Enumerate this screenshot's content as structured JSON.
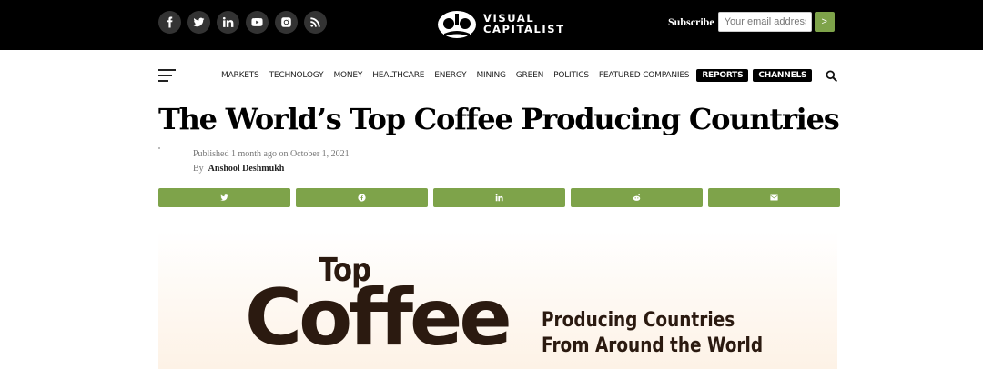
{
  "header": {
    "social_icons": [
      "facebook-icon",
      "twitter-icon",
      "linkedin-icon",
      "youtube-icon",
      "instagram-icon",
      "rss-icon"
    ],
    "logo": {
      "line1": "VISUAL",
      "line2": "CAPITALIST"
    },
    "subscribe": {
      "label": "Subscribe",
      "placeholder": "Your email address",
      "button_label": ">"
    }
  },
  "nav": {
    "items": [
      "MARKETS",
      "TECHNOLOGY",
      "MONEY",
      "HEALTHCARE",
      "ENERGY",
      "MINING",
      "GREEN",
      "POLITICS",
      "FEATURED COMPANIES"
    ],
    "pills": [
      "REPORTS",
      "CHANNELS"
    ]
  },
  "article": {
    "title": "The World’s Top Coffee Producing Countries",
    "published": "Published 1 month ago on October 1, 2021",
    "by": "By",
    "author": "Anshool Deshmukh"
  },
  "share_icons": [
    "twitter-icon",
    "facebook-icon",
    "linkedin-icon",
    "reddit-icon",
    "email-icon"
  ],
  "hero": {
    "top_word": "Top",
    "big_word": "Coffee",
    "subtitle_line1": "Producing Countries",
    "subtitle_line2": "From Around the World"
  },
  "colors": {
    "accent": "#7ea34a",
    "topbar": "#000000",
    "coffee_brown": "#2b1a10"
  }
}
